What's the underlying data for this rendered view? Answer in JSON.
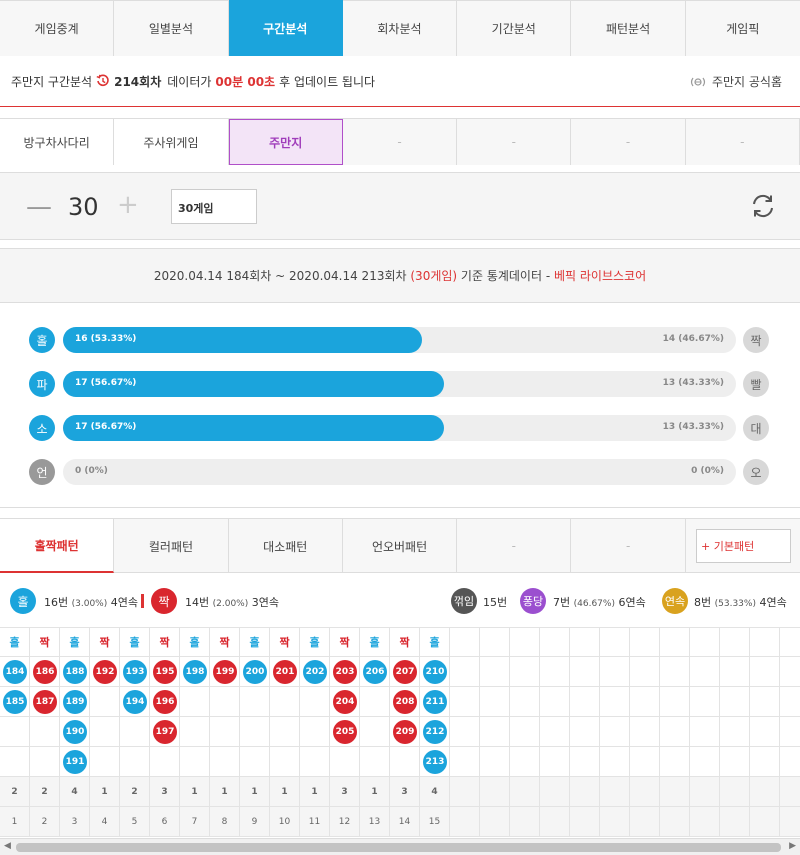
{
  "topnav": [
    "게임중계",
    "일별분석",
    "구간분석",
    "회차분석",
    "기간분석",
    "패턴분석",
    "게임픽"
  ],
  "topnav_active": 2,
  "info": {
    "prefix": "주만지 구간분석",
    "round": "214회차",
    "mid": "데이터가",
    "time": "00분 00초",
    "suffix": "후 업데이트 됩니다",
    "official": "주만지 공식홈"
  },
  "subtabs": [
    "방구차사다리",
    "주사위게임",
    "주만지",
    "-",
    "-",
    "-",
    "-"
  ],
  "subtabs_active": 2,
  "stepper": {
    "minus": "—",
    "value": "30",
    "plus": "+",
    "select": "30게임"
  },
  "stats_header": {
    "range": "2020.04.14 184회차 ~ 2020.04.14 213회차",
    "count": "(30게임)",
    "basis": "기준 통계데이터 -",
    "source": "베픽 라이브스코어"
  },
  "bars": [
    {
      "left": "홀",
      "right": "짝",
      "left_value": "16 (53.33%)",
      "right_value": "14 (46.67%)",
      "fraction": 0.5333
    },
    {
      "left": "파",
      "right": "빨",
      "left_value": "17 (56.67%)",
      "right_value": "13 (43.33%)",
      "fraction": 0.5667
    },
    {
      "left": "소",
      "right": "대",
      "left_value": "17 (56.67%)",
      "right_value": "13 (43.33%)",
      "fraction": 0.5667
    },
    {
      "left": "언",
      "right": "오",
      "left_value": "0 (0%)",
      "right_value": "0 (0%)",
      "fraction": 0
    }
  ],
  "pattern_tabs": [
    "홀짝패턴",
    "컬러패턴",
    "대소패턴",
    "언오버패턴",
    "-",
    "-"
  ],
  "pattern_active": 0,
  "basic_pattern": "+ 기본패턴",
  "summary": {
    "odd": {
      "label": "홀",
      "count": "16번",
      "pct": "(3.00%)",
      "streak": "4연속"
    },
    "even": {
      "label": "짝",
      "count": "14번",
      "pct": "(2.00%)",
      "streak": "3연속"
    },
    "break": {
      "label": "꺾임",
      "count": "15번"
    },
    "pong": {
      "label": "퐁당",
      "count": "7번",
      "pct": "(46.67%)",
      "streak": "6연속"
    },
    "seq": {
      "label": "연속",
      "count": "8번",
      "pct": "(53.33%)",
      "streak": "4연속"
    }
  },
  "colors": {
    "blue": "#1ba4dc",
    "red": "#d9262e",
    "purple": "#9b4fcf",
    "gold": "#d9a21f",
    "dark": "#555555"
  },
  "pattern_columns": [
    {
      "header": "홀",
      "type": "b",
      "rounds": [
        "184",
        "185"
      ]
    },
    {
      "header": "짝",
      "type": "r",
      "rounds": [
        "186",
        "187"
      ]
    },
    {
      "header": "홀",
      "type": "b",
      "rounds": [
        "188",
        "189",
        "190",
        "191"
      ]
    },
    {
      "header": "짝",
      "type": "r",
      "rounds": [
        "192"
      ]
    },
    {
      "header": "홀",
      "type": "b",
      "rounds": [
        "193",
        "194"
      ]
    },
    {
      "header": "짝",
      "type": "r",
      "rounds": [
        "195",
        "196",
        "197"
      ]
    },
    {
      "header": "홀",
      "type": "b",
      "rounds": [
        "198"
      ]
    },
    {
      "header": "짝",
      "type": "r",
      "rounds": [
        "199"
      ]
    },
    {
      "header": "홀",
      "type": "b",
      "rounds": [
        "200"
      ]
    },
    {
      "header": "짝",
      "type": "r",
      "rounds": [
        "201"
      ]
    },
    {
      "header": "홀",
      "type": "b",
      "rounds": [
        "202"
      ]
    },
    {
      "header": "짝",
      "type": "r",
      "rounds": [
        "203",
        "204",
        "205"
      ]
    },
    {
      "header": "홀",
      "type": "b",
      "rounds": [
        "206"
      ]
    },
    {
      "header": "짝",
      "type": "r",
      "rounds": [
        "207",
        "208",
        "209"
      ]
    },
    {
      "header": "홀",
      "type": "b",
      "rounds": [
        "210",
        "211",
        "212",
        "213"
      ]
    }
  ],
  "column_counts": [
    "2",
    "2",
    "4",
    "1",
    "2",
    "3",
    "1",
    "1",
    "1",
    "1",
    "1",
    "3",
    "1",
    "3",
    "4"
  ],
  "column_indexes": [
    "1",
    "2",
    "3",
    "4",
    "5",
    "6",
    "7",
    "8",
    "9",
    "10",
    "11",
    "12",
    "13",
    "14",
    "15"
  ]
}
